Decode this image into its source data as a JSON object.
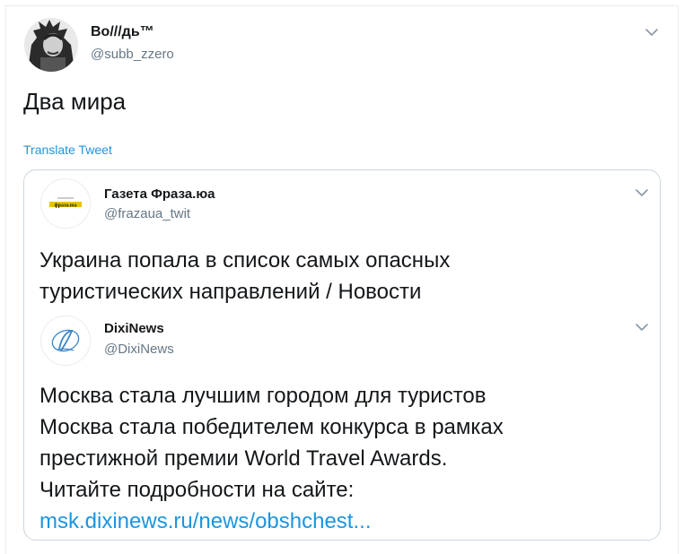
{
  "tweet": {
    "author_name": "Во///дь™",
    "author_handle": "@subb_zzero",
    "text": "Два мира",
    "translate_label": "Translate Tweet",
    "avatar_icon": "portrait-avatar-icon",
    "menu_icon": "chevron-down-icon"
  },
  "quoted_tweet": {
    "author_name": "Газета Фраза.юа",
    "author_handle": "@frazaua_twit",
    "avatar_logo_text": "фраза.юа",
    "text_lines": [
      "Украина попала в список самых опасных",
      "туристических направлений / Новости"
    ]
  },
  "nested_tweet": {
    "author_name": "DixiNews",
    "author_handle": "@DixiNews",
    "avatar_icon": "dixinews-logo-icon",
    "text_lines": [
      "Москва стала лучшим городом для туристов",
      "Москва стала победителем конкурса в рамках",
      "престижной премии World Travel Awards.",
      "Читайте подробности на сайте:"
    ],
    "link_text": "msk.dixinews.ru/news/obshchest..."
  },
  "colors": {
    "link": "#1b95e0",
    "secondary_text": "#657786",
    "border": "#ccd6dd"
  }
}
